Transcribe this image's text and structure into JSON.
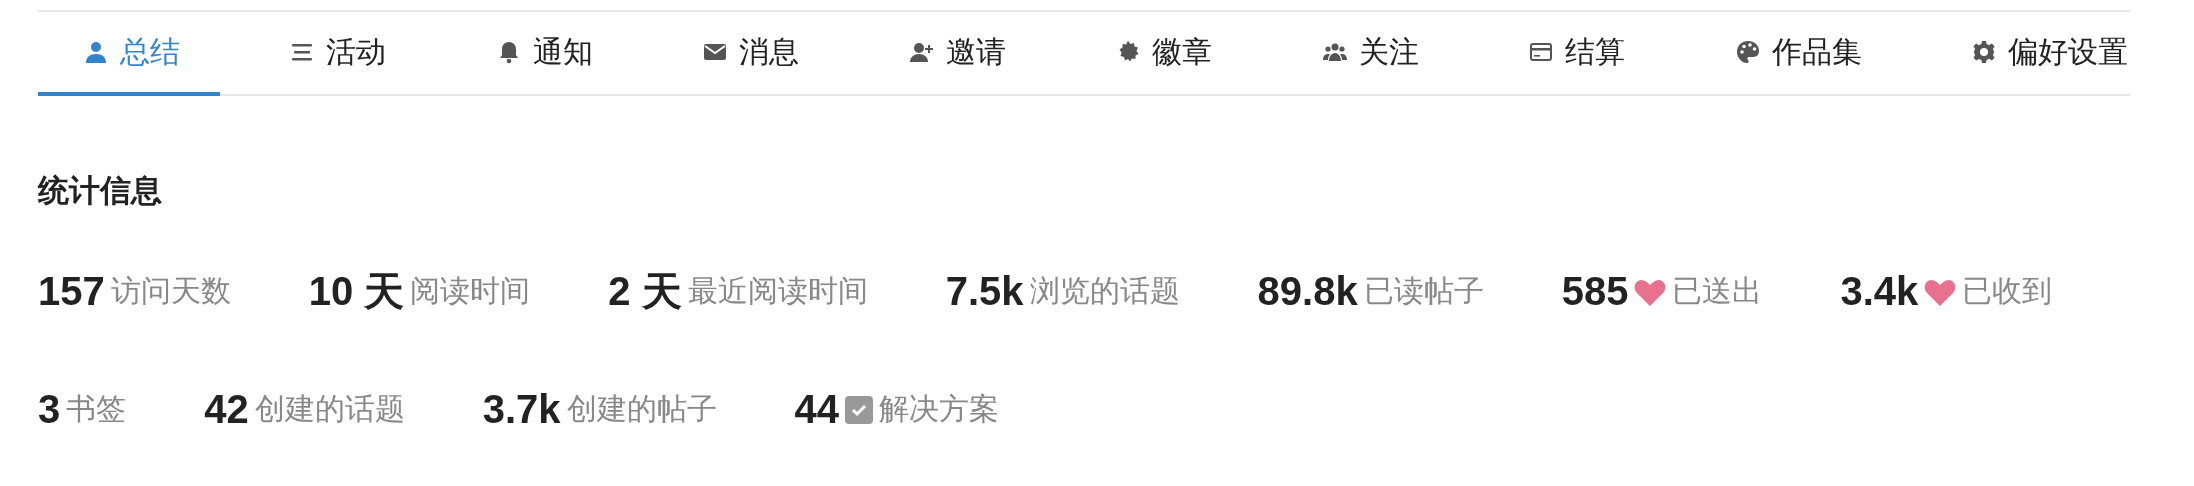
{
  "tabs": [
    {
      "label": "总结",
      "selected": true
    },
    {
      "label": "活动",
      "selected": false
    },
    {
      "label": "通知",
      "selected": false
    },
    {
      "label": "消息",
      "selected": false
    },
    {
      "label": "邀请",
      "selected": false
    },
    {
      "label": "徽章",
      "selected": false
    },
    {
      "label": "关注",
      "selected": false
    },
    {
      "label": "结算",
      "selected": false
    },
    {
      "label": "作品集",
      "selected": false
    },
    {
      "label": "偏好设置",
      "selected": false
    }
  ],
  "stats": {
    "title": "统计信息",
    "rows": [
      [
        {
          "value": "157",
          "label": "访问天数",
          "kind": "plain"
        },
        {
          "value": "10 天",
          "label": "阅读时间",
          "kind": "plain"
        },
        {
          "value": "2 天",
          "label": "最近阅读时间",
          "kind": "plain"
        },
        {
          "value": "7.5k",
          "label": "浏览的话题",
          "kind": "plain"
        },
        {
          "value": "89.8k",
          "label": "已读帖子",
          "kind": "plain"
        },
        {
          "value": "585",
          "label": "已送出",
          "kind": "heart"
        },
        {
          "value": "3.4k",
          "label": "已收到",
          "kind": "heart"
        }
      ],
      [
        {
          "value": "3",
          "label": "书签",
          "kind": "plain"
        },
        {
          "value": "42",
          "label": "创建的话题",
          "kind": "plain"
        },
        {
          "value": "3.7k",
          "label": "创建的帖子",
          "kind": "plain"
        },
        {
          "value": "44",
          "label": "解决方案",
          "kind": "check"
        }
      ]
    ]
  }
}
